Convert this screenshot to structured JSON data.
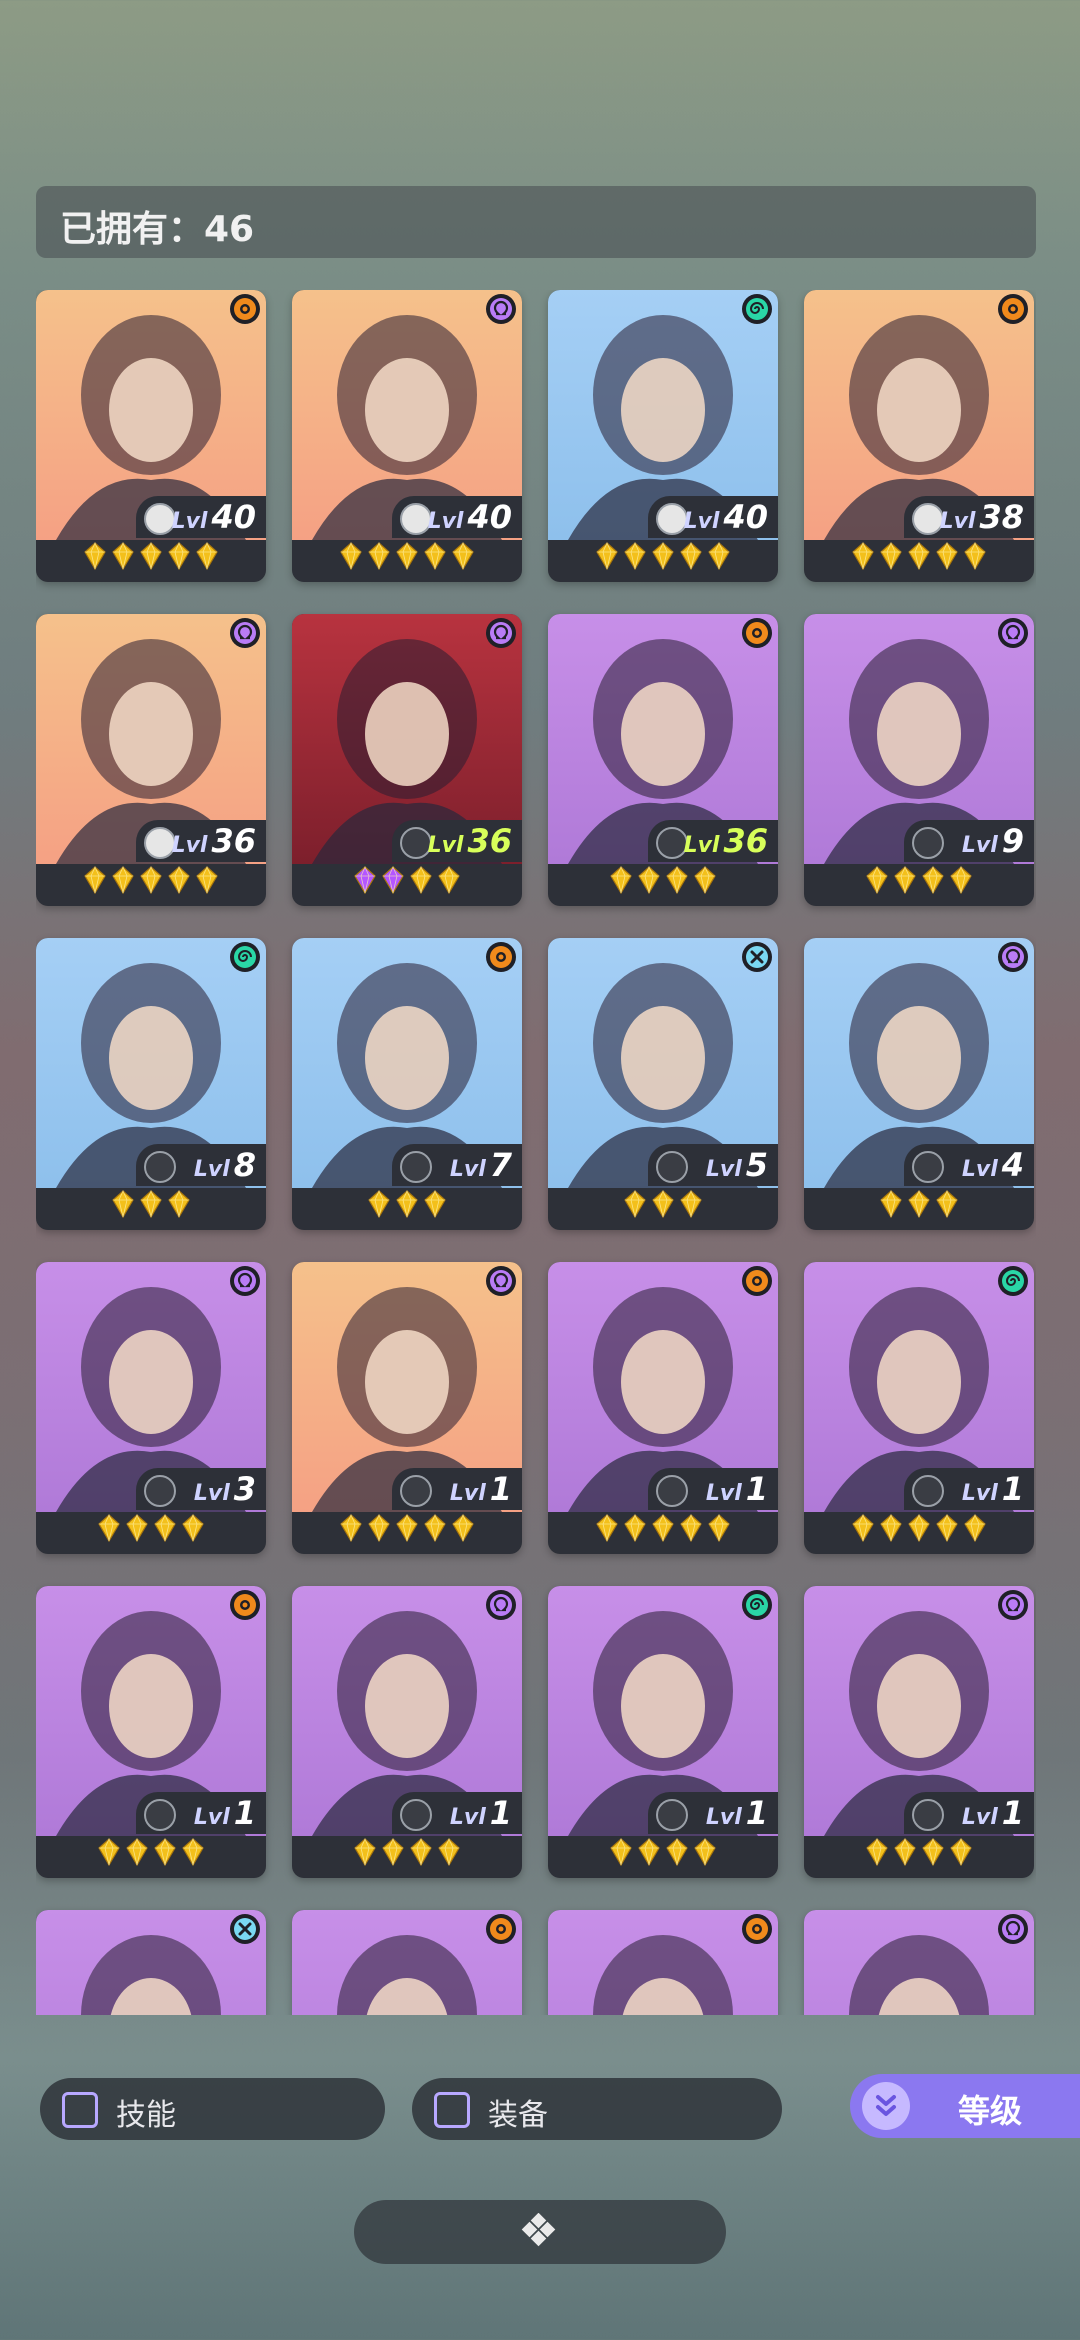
{
  "header": {
    "owned_label": "已拥有：46"
  },
  "colors": {
    "accent": "#8b78f0",
    "gem": "#f3c01b",
    "gem_purple": "#b456ff"
  },
  "heroes": [
    {
      "faction": "sun",
      "level": "40",
      "skill": "on",
      "stars": 5,
      "purple": 0,
      "bg": [
        "#f5c18b",
        "#f5a184"
      ]
    },
    {
      "faction": "omega",
      "level": "40",
      "skill": "on",
      "stars": 5,
      "purple": 0,
      "bg": [
        "#f5c18b",
        "#f5a184"
      ]
    },
    {
      "faction": "swirl",
      "level": "40",
      "skill": "on",
      "stars": 5,
      "purple": 0,
      "bg": [
        "#a5cff5",
        "#8ec0ec"
      ]
    },
    {
      "faction": "sun",
      "level": "38",
      "skill": "on",
      "stars": 5,
      "purple": 0,
      "bg": [
        "#f5c18b",
        "#f5a184"
      ]
    },
    {
      "faction": "omega",
      "level": "36",
      "skill": "on",
      "stars": 5,
      "purple": 0,
      "bg": [
        "#f5c18b",
        "#f5a184"
      ]
    },
    {
      "faction": "omega",
      "level": "36",
      "skill": "off",
      "stars": 4,
      "purple": 2,
      "max": true,
      "bg": [
        "#b8333f",
        "#7d1f2c"
      ]
    },
    {
      "faction": "sun",
      "level": "36",
      "skill": "off",
      "stars": 4,
      "purple": 0,
      "max": true,
      "bg": [
        "#c78fe8",
        "#b07ad8"
      ]
    },
    {
      "faction": "omega",
      "level": "9",
      "skill": "off",
      "stars": 4,
      "purple": 0,
      "bg": [
        "#c78fe8",
        "#b07ad8"
      ]
    },
    {
      "faction": "swirl",
      "level": "8",
      "skill": "off",
      "stars": 3,
      "purple": 0,
      "bg": [
        "#a5cff5",
        "#8ec0ec"
      ]
    },
    {
      "faction": "sun",
      "level": "7",
      "skill": "off",
      "stars": 3,
      "purple": 0,
      "bg": [
        "#a5cff5",
        "#8ec0ec"
      ]
    },
    {
      "faction": "cross",
      "level": "5",
      "skill": "off",
      "stars": 3,
      "purple": 0,
      "bg": [
        "#a5cff5",
        "#8ec0ec"
      ]
    },
    {
      "faction": "omega",
      "level": "4",
      "skill": "off",
      "stars": 3,
      "purple": 0,
      "bg": [
        "#a5cff5",
        "#8ec0ec"
      ]
    },
    {
      "faction": "omega",
      "level": "3",
      "skill": "off",
      "stars": 4,
      "purple": 0,
      "bg": [
        "#c78fe8",
        "#b07ad8"
      ]
    },
    {
      "faction": "omega",
      "level": "1",
      "skill": "off",
      "stars": 5,
      "purple": 0,
      "bg": [
        "#f5c18b",
        "#f5a184"
      ]
    },
    {
      "faction": "sun",
      "level": "1",
      "skill": "off",
      "stars": 5,
      "purple": 0,
      "bg": [
        "#c78fe8",
        "#b07ad8"
      ]
    },
    {
      "faction": "swirl",
      "level": "1",
      "skill": "off",
      "stars": 5,
      "purple": 0,
      "bg": [
        "#c78fe8",
        "#b07ad8"
      ]
    },
    {
      "faction": "sun",
      "level": "1",
      "skill": "off",
      "stars": 4,
      "purple": 0,
      "bg": [
        "#c78fe8",
        "#b07ad8"
      ]
    },
    {
      "faction": "omega",
      "level": "1",
      "skill": "off",
      "stars": 4,
      "purple": 0,
      "bg": [
        "#c78fe8",
        "#b07ad8"
      ]
    },
    {
      "faction": "swirl",
      "level": "1",
      "skill": "off",
      "stars": 4,
      "purple": 0,
      "bg": [
        "#c78fe8",
        "#b07ad8"
      ]
    },
    {
      "faction": "omega",
      "level": "1",
      "skill": "off",
      "stars": 4,
      "purple": 0,
      "bg": [
        "#c78fe8",
        "#b07ad8"
      ]
    },
    {
      "faction": "cross",
      "level": "",
      "skill": "off",
      "stars": 0,
      "purple": 0,
      "bg": [
        "#c78fe8",
        "#b07ad8"
      ]
    },
    {
      "faction": "sun",
      "level": "",
      "skill": "off",
      "stars": 0,
      "purple": 0,
      "bg": [
        "#c78fe8",
        "#b07ad8"
      ]
    },
    {
      "faction": "sun",
      "level": "",
      "skill": "off",
      "stars": 0,
      "purple": 0,
      "bg": [
        "#c78fe8",
        "#b07ad8"
      ]
    },
    {
      "faction": "omega",
      "level": "",
      "skill": "off",
      "stars": 0,
      "purple": 0,
      "bg": [
        "#c78fe8",
        "#b07ad8"
      ]
    }
  ],
  "lvl_prefix": "Lvl",
  "filters": {
    "skill_label": "技能",
    "equip_label": "装备"
  },
  "sort": {
    "label": "等级",
    "icon": "double-chevron-down-icon"
  },
  "bottom_toggle": {
    "icon": "diamond-cluster-icon"
  }
}
